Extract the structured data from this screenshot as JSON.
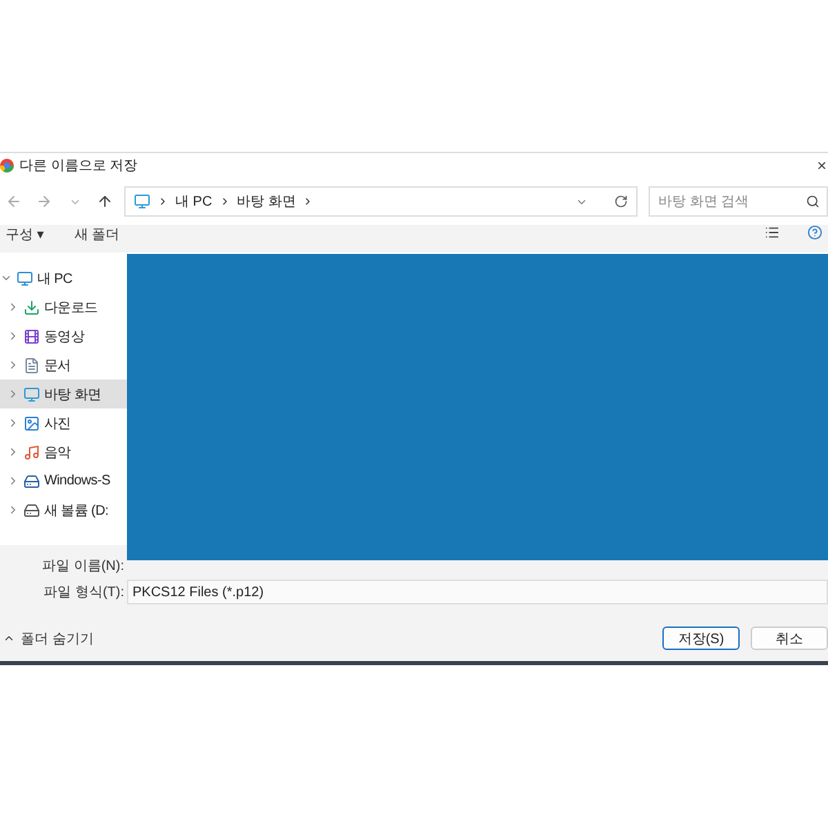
{
  "window": {
    "title": "다른 이름으로 저장",
    "close": "×"
  },
  "address": {
    "path": [
      "내 PC",
      "바탕 화면"
    ]
  },
  "search": {
    "placeholder": "바탕 화면 검색"
  },
  "toolbar": [
    "구성 ▾",
    "새 폴더"
  ],
  "tree": [
    {
      "label": "내 PC",
      "kind": "pc",
      "expanded": true,
      "selected": false,
      "children": [
        {
          "label": "다운로드",
          "kind": "downloads",
          "expanded": false,
          "selected": false
        },
        {
          "label": "동영상",
          "kind": "videos",
          "expanded": false,
          "selected": false
        },
        {
          "label": "문서",
          "kind": "documents",
          "expanded": false,
          "selected": false
        },
        {
          "label": "바탕 화면",
          "kind": "desktop",
          "expanded": false,
          "selected": true
        },
        {
          "label": "사진",
          "kind": "pictures",
          "expanded": false,
          "selected": false
        },
        {
          "label": "음악",
          "kind": "music",
          "expanded": false,
          "selected": false
        },
        {
          "label": "Windows-S",
          "kind": "system",
          "expanded": false,
          "selected": false
        },
        {
          "label": "새 볼륨 (D:",
          "kind": "drive",
          "expanded": false,
          "selected": false
        }
      ]
    }
  ],
  "file_name": {
    "label": "파일 이름(N):"
  },
  "file_type": {
    "label": "파일 형식(T):",
    "value": "PKCS12 Files (*.p12)"
  },
  "hide_folders": "폴더 숨기기",
  "buttons": [
    {
      "label": "저장(S)",
      "default": true
    },
    {
      "label": "취소",
      "default": false
    }
  ]
}
